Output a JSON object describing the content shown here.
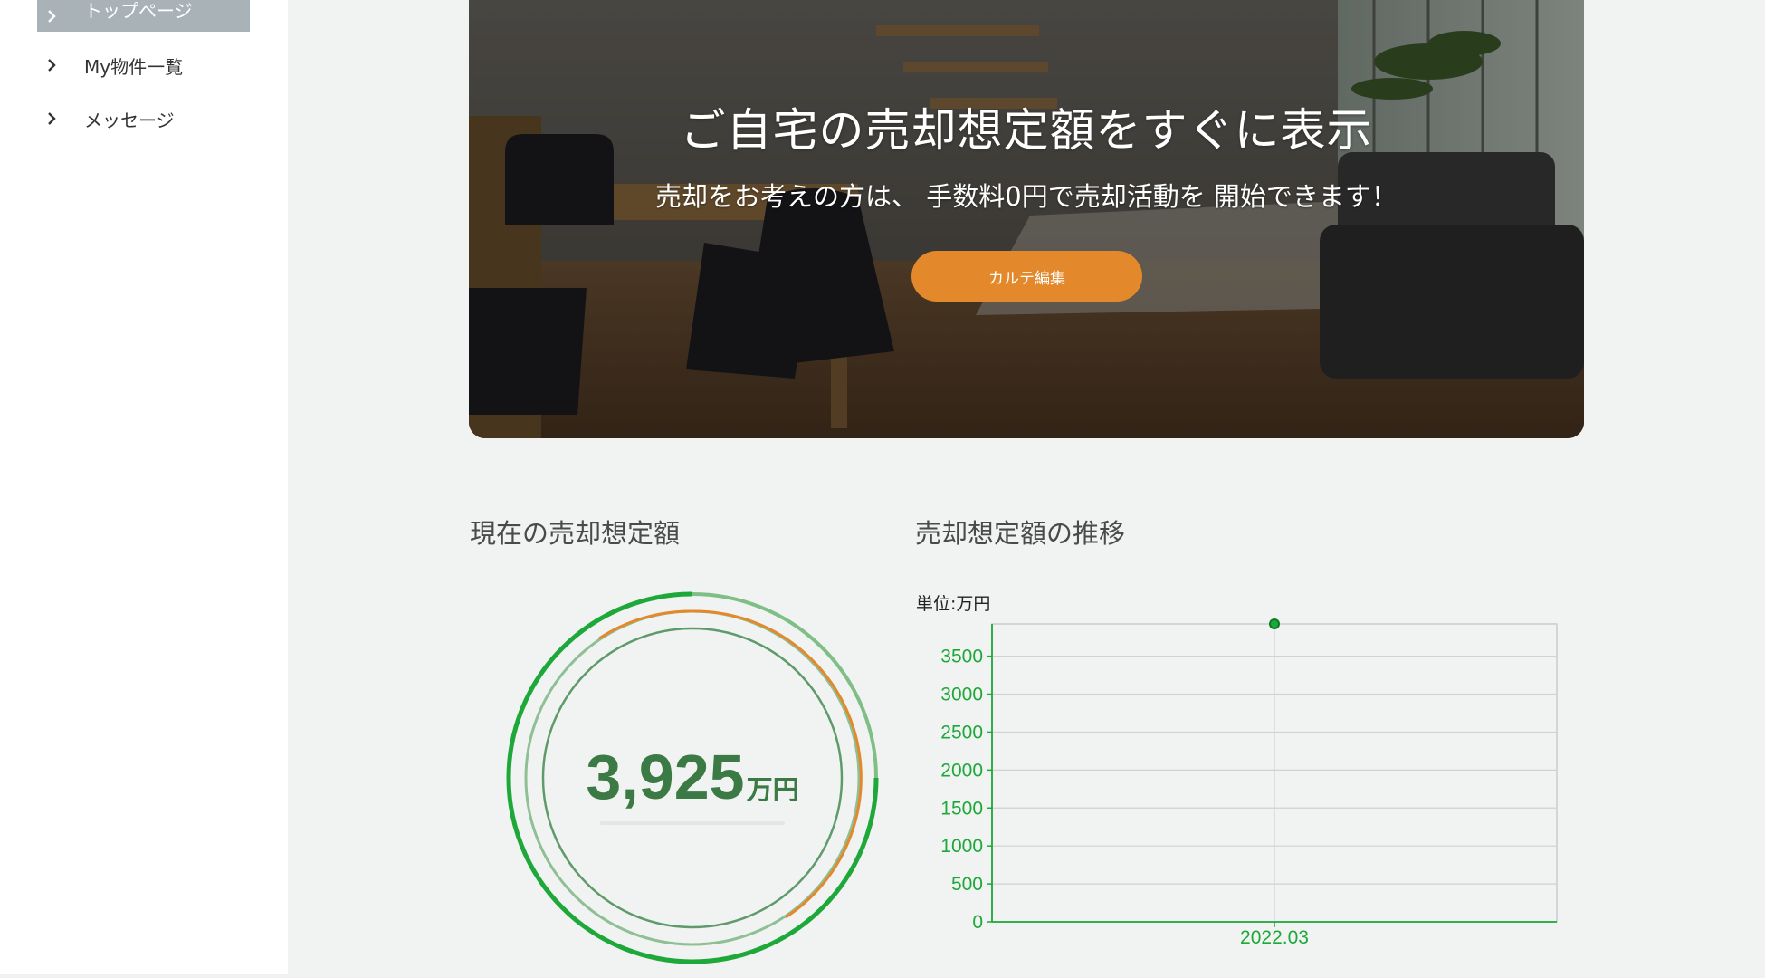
{
  "sidebar": {
    "items": [
      {
        "label": "トップページ"
      },
      {
        "label": "My物件一覧"
      },
      {
        "label": "メッセージ"
      }
    ]
  },
  "hero": {
    "title": "ご自宅の売却想定額をすぐに表示",
    "subtitle": "売却をお考えの方は、 手数料0円で売却活動を 開始できます！",
    "button_label": "カルテ編集"
  },
  "current": {
    "title": "現在の売却想定額",
    "value": "3,925",
    "unit": "万円"
  },
  "trend": {
    "title": "売却想定額の推移",
    "unit_label": "単位:万円"
  },
  "colors": {
    "accent_orange": "#e3892c",
    "green": "#1ea83a",
    "dark_green": "#3b7a45",
    "sidebar_active": "#a9b3b7"
  },
  "chart_data": {
    "type": "line",
    "x": [
      "2022.03"
    ],
    "series": [
      {
        "values": [
          3925
        ]
      }
    ],
    "ylim": [
      0,
      3925
    ],
    "yticks": [
      0,
      500,
      1000,
      1500,
      2000,
      2500,
      3000,
      3500
    ],
    "grid": true
  }
}
